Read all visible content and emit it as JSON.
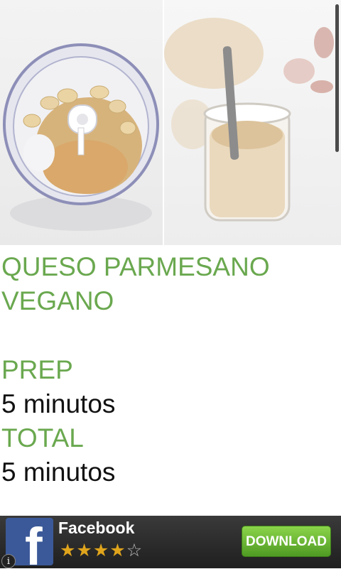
{
  "recipe": {
    "title_line1": "QUESO PARMESANO",
    "title_line2": "VEGANO",
    "prep_label": "PREP",
    "prep_value": "5 minutos",
    "total_label": "TOTAL",
    "total_value": "5 minutos"
  },
  "photos": {
    "left_icon": "food-processor-icon",
    "right_icon": "jar-icon"
  },
  "ad": {
    "app_name": "Facebook",
    "rating": 4,
    "max_rating": 5,
    "download_label": "DOWNLOAD",
    "logo_letter": "f",
    "info_label": "i",
    "colors": {
      "brand": "#3b5998",
      "button": "#6cbf33",
      "bar": "#2b2b2b"
    }
  },
  "colors": {
    "accent": "#6aa84f",
    "text": "#111111"
  }
}
